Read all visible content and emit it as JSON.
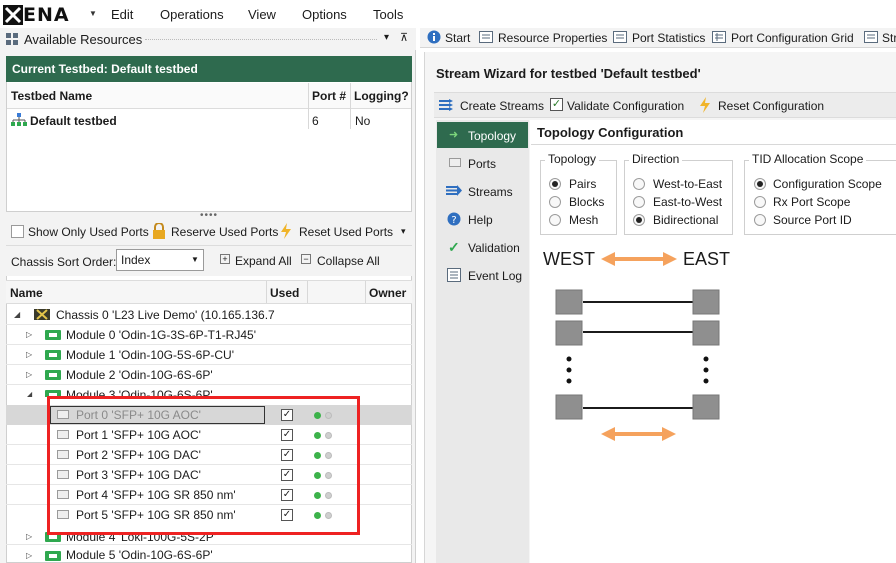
{
  "app": {
    "logo_text": "ENA",
    "menu": [
      "Edit",
      "Operations",
      "View",
      "Options",
      "Tools"
    ]
  },
  "left": {
    "resources_title": "Available Resources",
    "pin_glyphs": [
      "▾",
      "⊼"
    ],
    "testbed_header": "Current Testbed: Default testbed",
    "testbed_columns": [
      "Testbed Name",
      "Port #",
      "Logging?"
    ],
    "testbed_row": {
      "name": "Default testbed",
      "ports": "6",
      "logging": "No"
    },
    "splitter": "••••",
    "toolbar": {
      "show_used": "Show Only Used Ports",
      "reserve": "Reserve Used Ports",
      "reset": "Reset Used Ports"
    },
    "sort_label": "Chassis Sort Order:",
    "sort_value": "Index",
    "expand_all": "Expand All",
    "collapse_all": "Collapse All",
    "tree_columns": [
      "Name",
      "Used",
      "Owner"
    ],
    "chassis": "Chassis 0 'L23 Live Demo' (10.165.136.7",
    "modules_before": [
      "Module 0 'Odin-1G-3S-6P-T1-RJ45'",
      "Module 1 'Odin-10G-5S-6P-CU'",
      "Module 2 'Odin-10G-6S-6P'",
      "Module 3 'Odin-10G-6S-6P'"
    ],
    "ports": [
      "Port 0 'SFP+ 10G AOC'",
      "Port 1 'SFP+ 10G AOC'",
      "Port 2 'SFP+ 10G DAC'",
      "Port 3 'SFP+ 10G DAC'",
      "Port 4 'SFP+ 10G SR 850 nm'",
      "Port 5 'SFP+ 10G SR 850 nm'"
    ],
    "modules_after": [
      "Module 4 'Loki-100G-5S-2P'",
      "Module 5 'Odin-10G-6S-6P'"
    ]
  },
  "tabs": [
    "Start",
    "Resource Properties",
    "Port Statistics",
    "Port Configuration Grid",
    "Str"
  ],
  "wizard": {
    "title": "Stream Wizard for testbed 'Default testbed'",
    "toolbar": {
      "create": "Create Streams",
      "validate": "Validate Configuration",
      "reset": "Reset Configuration"
    },
    "nav": [
      "Topology",
      "Ports",
      "Streams",
      "Help",
      "Validation",
      "Event Log"
    ],
    "content_title": "Topology Configuration",
    "topology_group": {
      "label": "Topology",
      "options": [
        "Pairs",
        "Blocks",
        "Mesh"
      ],
      "selected": "Pairs"
    },
    "direction_group": {
      "label": "Direction",
      "options": [
        "West-to-East",
        "East-to-West",
        "Bidirectional"
      ],
      "selected": "Bidirectional"
    },
    "tid_group": {
      "label": "TID Allocation Scope",
      "options": [
        "Configuration Scope",
        "Rx Port Scope",
        "Source Port ID"
      ],
      "selected": "Configuration Scope"
    },
    "diagram": {
      "west": "WEST",
      "east": "EAST",
      "arrow_color": "#f5a25d",
      "port_color": "#8f8f8f"
    }
  },
  "colors": {
    "header_green": "#2e6a4e",
    "highlight_red": "#e22222",
    "led_green": "#3cb24a"
  }
}
